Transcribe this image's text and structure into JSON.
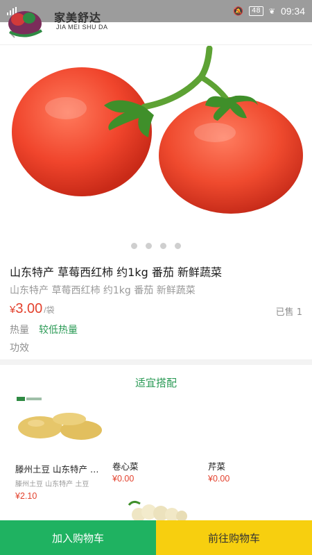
{
  "status_bar": {
    "time": "09:34",
    "battery": "48"
  },
  "brand": {
    "name_cn": "家美舒达",
    "name_en": "JIA MEI SHU DA"
  },
  "product": {
    "title": "山东特产 草莓西红柿 约1kg 番茄 新鲜蔬菜",
    "subtitle": "山东特产 草莓西红柿 约1kg 番茄 新鲜蔬菜",
    "price_symbol": "¥",
    "price": "3.00",
    "unit": "/袋",
    "sold": "已售 1",
    "calorie_label": "热量",
    "calorie_value": "较低热量",
    "efficacy_label": "功效",
    "image_icon": "tomato-photo"
  },
  "carousel": {
    "count": 4,
    "active_index": 0
  },
  "pairing": {
    "title": "适宜搭配",
    "items": [
      {
        "name": "滕州土豆 山东特产 土豆",
        "sub": "滕州土豆 山东特产 土豆",
        "price": "¥2.10",
        "image": "potato-photo"
      },
      {
        "name": "卷心菜",
        "sub": "",
        "price": "¥0.00",
        "image": ""
      },
      {
        "name": "芹菜",
        "sub": "",
        "price": "¥0.00",
        "image": ""
      },
      {
        "name": "",
        "sub": "",
        "price": "",
        "image": "cauliflower-photo"
      }
    ]
  },
  "actions": {
    "add_to_cart": "加入购物车",
    "go_to_cart": "前往购物车"
  },
  "colors": {
    "accent_green": "#1fb261",
    "accent_yellow": "#f7cf0f",
    "price_red": "#e3412d"
  }
}
